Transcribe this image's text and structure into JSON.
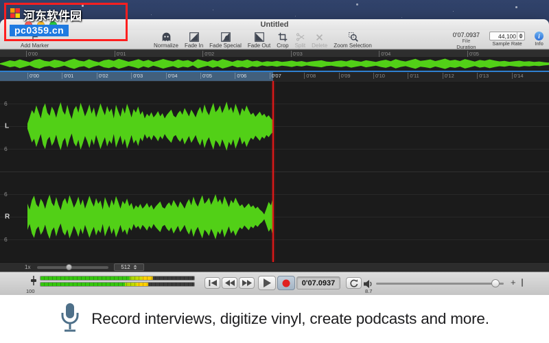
{
  "watermark": {
    "site_name": "河东软件园",
    "site_url": "pc0359.cn"
  },
  "window": {
    "title": "Untitled"
  },
  "toolbar": {
    "add_marker_label": "Add Marker",
    "items": [
      {
        "id": "normalize",
        "label": "Normalize",
        "icon": "ghost-icon",
        "enabled": true
      },
      {
        "id": "fade-in",
        "label": "Fade In",
        "icon": "fade-in-icon",
        "enabled": true
      },
      {
        "id": "fade-special",
        "label": "Fade Special",
        "icon": "fade-special-icon",
        "enabled": true
      },
      {
        "id": "fade-out",
        "label": "Fade Out",
        "icon": "fade-out-icon",
        "enabled": true
      },
      {
        "id": "crop",
        "label": "Crop",
        "icon": "crop-icon",
        "enabled": true
      },
      {
        "id": "split",
        "label": "Split",
        "icon": "scissors-icon",
        "enabled": false
      },
      {
        "id": "delete",
        "label": "Delete",
        "icon": "delete-x-icon",
        "enabled": false
      },
      {
        "id": "zoom-selection",
        "label": "Zoom Selection",
        "icon": "magnifier-icon",
        "enabled": true
      }
    ],
    "duration": {
      "value": "0'07.0937",
      "file_label": "File",
      "label": "Duration"
    },
    "sample_rate": {
      "value": "44,100",
      "label": "Sample Rate"
    },
    "info_label": "Info",
    "info_glyph": "i"
  },
  "overview_ruler": {
    "labels": [
      "0'00",
      "0'01",
      "0'02",
      "0'03",
      "0'04",
      "0'05"
    ]
  },
  "main_ruler": {
    "labels": [
      "0'00",
      "0'01",
      "0'02",
      "0'03",
      "0'04",
      "0'05",
      "0'06",
      "0'07",
      "0'08",
      "0'09",
      "0'10",
      "0'11",
      "0'12",
      "0'13",
      "0'14"
    ]
  },
  "editor": {
    "channels": [
      {
        "name": "L"
      },
      {
        "name": "R"
      }
    ],
    "scale_label": "6",
    "zoom_reset_label": "1x",
    "samples_per_pixel": "512"
  },
  "transport": {
    "time_display": "0'07.0937",
    "gain_value": "100",
    "volume_value": "8.7",
    "volume_plus_label": "+"
  },
  "banner": {
    "text": "Record interviews, digitize vinyl, create podcasts and more."
  },
  "colors": {
    "waveform_green": "#52d017",
    "playhead_red": "#e01818",
    "selection_blue": "#2f80d0"
  },
  "waveform": {
    "amplitudes": [
      0.1,
      0.35,
      0.62,
      0.48,
      0.8,
      0.55,
      0.3,
      0.7,
      0.88,
      0.52,
      0.4,
      0.75,
      0.6,
      0.33,
      0.68,
      0.92,
      0.58,
      0.44,
      0.82,
      0.5,
      0.28,
      0.64,
      0.78,
      0.52,
      0.9,
      0.66,
      0.38,
      0.58,
      0.84,
      0.48,
      0.72,
      0.34,
      0.6,
      0.88,
      0.62,
      0.42,
      0.78,
      0.54,
      0.68,
      0.3,
      0.82,
      0.58,
      0.36,
      0.72,
      0.48,
      0.86,
      0.62,
      0.34,
      0.66,
      0.52,
      0.76,
      0.44,
      0.58,
      0.3,
      0.48,
      0.38,
      0.54,
      0.34,
      0.44,
      0.58,
      0.38,
      0.5,
      0.3,
      0.44,
      0.54,
      0.64,
      0.4,
      0.34,
      0.5,
      0.6,
      0.44,
      0.7,
      0.54,
      0.38,
      0.64,
      0.5,
      0.34,
      0.58,
      0.74,
      0.48,
      0.84,
      0.58,
      0.42,
      0.68,
      0.9,
      0.54,
      0.64,
      0.8,
      0.5,
      0.7,
      0.94,
      0.6,
      0.74,
      0.5,
      0.86,
      0.64,
      0.4,
      0.7,
      0.56,
      0.8,
      0.6,
      0.44,
      0.52,
      0.36,
      0.46,
      0.56,
      0.4,
      0.48,
      0.34,
      0.42,
      0.3,
      0.22
    ]
  }
}
